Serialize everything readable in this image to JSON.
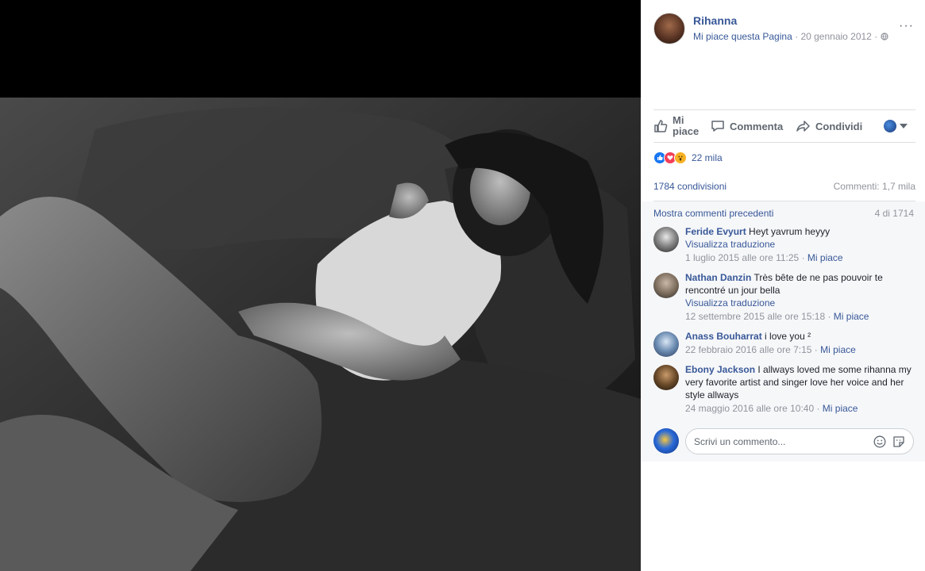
{
  "post": {
    "page_name": "Rihanna",
    "like_page_label": "Mi piace questa Pagina",
    "date": "20 gennaio 2012",
    "separator": "·",
    "more_label": "···"
  },
  "actions": {
    "like_label": "Mi piace",
    "comment_label": "Commenta",
    "share_label": "Condividi"
  },
  "reactions": {
    "count": "22 mila",
    "types": [
      "like",
      "love",
      "wow"
    ]
  },
  "stats": {
    "shares": "1784 condivisioni",
    "comments": "Commenti: 1,7 mila"
  },
  "comments_section": {
    "show_previous": "Mostra commenti precedenti",
    "pager": "4 di 1714",
    "items": [
      {
        "author": "Feride Evyurt",
        "text": "Heyt yavrum heyyy",
        "translate": "Visualizza traduzione",
        "timestamp": "1 luglio 2015 alle ore 11:25",
        "like": "Mi piace"
      },
      {
        "author": "Nathan Danzin",
        "text": "Très bête de ne pas pouvoir te rencontré un jour bella",
        "translate": "Visualizza traduzione",
        "timestamp": "12 settembre 2015 alle ore 15:18",
        "like": "Mi piace"
      },
      {
        "author": "Anass Bouharrat",
        "text": "i love you ²",
        "timestamp": "22 febbraio 2016 alle ore 7:15",
        "like": "Mi piace"
      },
      {
        "author": "Ebony Jackson",
        "text": "I allways loved me some rihanna my very favorite artist and singer love her voice and her style allways",
        "timestamp": "24 maggio 2016 alle ore 10:40",
        "like": "Mi piace"
      }
    ]
  },
  "composer": {
    "placeholder": "Scrivi un commento..."
  },
  "colors": {
    "link": "#385898",
    "muted": "#90949c",
    "like_blue": "#1877f2",
    "love_red": "#f33e58",
    "wow_yellow": "#f7b125"
  }
}
